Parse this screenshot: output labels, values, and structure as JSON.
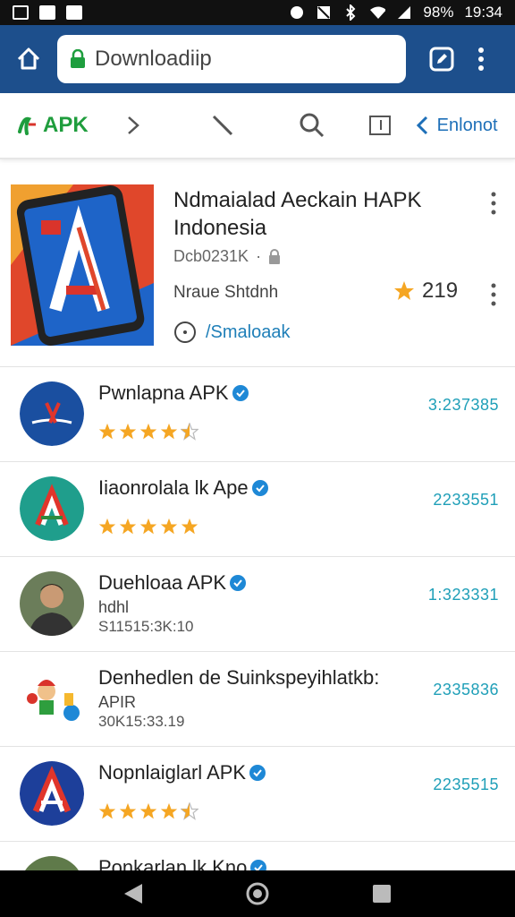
{
  "status_bar": {
    "battery": "98%",
    "time": "19:34"
  },
  "browser": {
    "url": "Downloadiip"
  },
  "toolbar": {
    "logo_text": "APK",
    "back_label": "Enlonot"
  },
  "featured": {
    "title": "Ndmaialad Aeckain HAPK Indonesia",
    "size": "Dcb0231K",
    "developer": "Nraue Shtdnh",
    "rating": "219",
    "link": "/Smaloaak"
  },
  "apps": [
    {
      "name": "Pwnlapna APK",
      "count": "3:237385",
      "rating": 4.5
    },
    {
      "name": "Iiaonrolala lk Ape",
      "count": "2233551",
      "rating": 5
    },
    {
      "name": "Duehloaa APK",
      "count": "1:323331",
      "line1": "hdhl",
      "line2": "S11515:3K:10"
    },
    {
      "name": "Denhedlen de Suinkspeyihlatkb:",
      "count": "2335836",
      "line1": "APIR",
      "line2": "30K15:33.19"
    },
    {
      "name": "Nopnlaiglarl APK",
      "count": "2235515",
      "rating": 4.5
    },
    {
      "name": "Ponkarlan lk Kno"
    }
  ],
  "colors": {
    "browser_bar": "#1d4f8c",
    "accent": "#1f9fb8",
    "star": "#f5a623",
    "apk_green": "#1f9d3d"
  }
}
